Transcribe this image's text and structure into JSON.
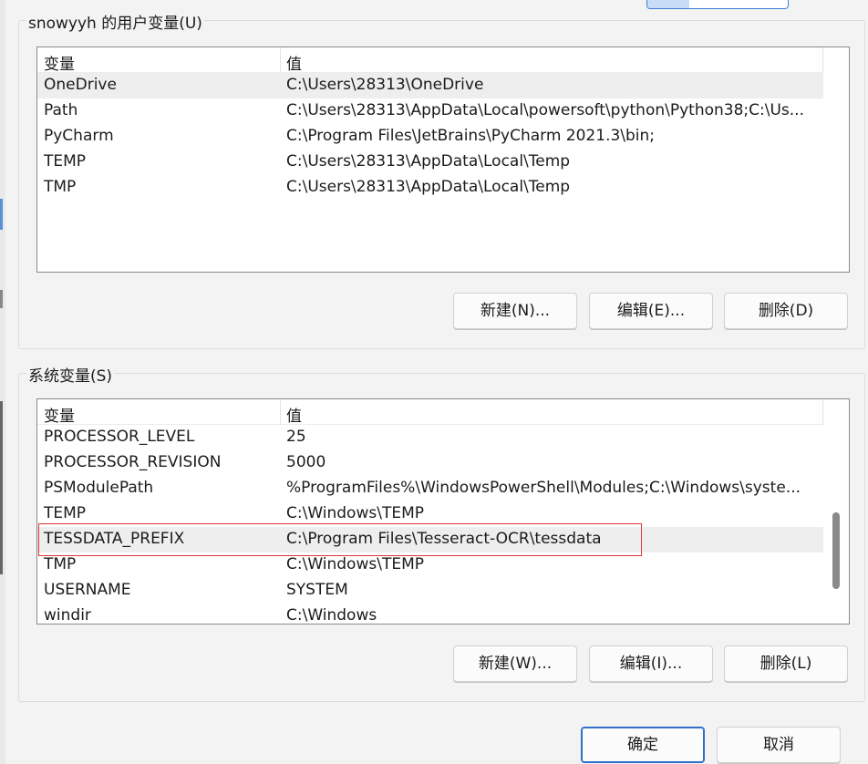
{
  "user_vars": {
    "title": "snowyyh 的用户变量(U)",
    "header": {
      "name": "变量",
      "value": "值"
    },
    "rows": [
      {
        "name": "OneDrive",
        "value": "C:\\Users\\28313\\OneDrive",
        "selected": true
      },
      {
        "name": "Path",
        "value": "C:\\Users\\28313\\AppData\\Local\\powersoft\\python\\Python38;C:\\Us..."
      },
      {
        "name": "PyCharm",
        "value": "C:\\Program Files\\JetBrains\\PyCharm 2021.3\\bin;"
      },
      {
        "name": "TEMP",
        "value": "C:\\Users\\28313\\AppData\\Local\\Temp"
      },
      {
        "name": "TMP",
        "value": "C:\\Users\\28313\\AppData\\Local\\Temp"
      }
    ],
    "buttons": {
      "new": "新建(N)...",
      "edit": "编辑(E)...",
      "delete": "删除(D)"
    }
  },
  "system_vars": {
    "title": "系统变量(S)",
    "header": {
      "name": "变量",
      "value": "值"
    },
    "rows": [
      {
        "name": "PROCESSOR_LEVEL",
        "value": "25"
      },
      {
        "name": "PROCESSOR_REVISION",
        "value": "5000"
      },
      {
        "name": "PSModulePath",
        "value": "%ProgramFiles%\\WindowsPowerShell\\Modules;C:\\Windows\\syste..."
      },
      {
        "name": "TEMP",
        "value": "C:\\Windows\\TEMP"
      },
      {
        "name": "TESSDATA_PREFIX",
        "value": "C:\\Program Files\\Tesseract-OCR\\tessdata",
        "selected": true,
        "highlighted": true
      },
      {
        "name": "TMP",
        "value": "C:\\Windows\\TEMP"
      },
      {
        "name": "USERNAME",
        "value": "SYSTEM"
      },
      {
        "name": "windir",
        "value": "C:\\Windows"
      }
    ],
    "buttons": {
      "new": "新建(W)...",
      "edit": "编辑(I)...",
      "delete": "删除(L)"
    }
  },
  "dialog_buttons": {
    "ok": "确定",
    "cancel": "取消"
  },
  "colors": {
    "accent": "#2f6fc7",
    "highlight_box": "#e0353a",
    "selected_row": "#eeeeee"
  }
}
